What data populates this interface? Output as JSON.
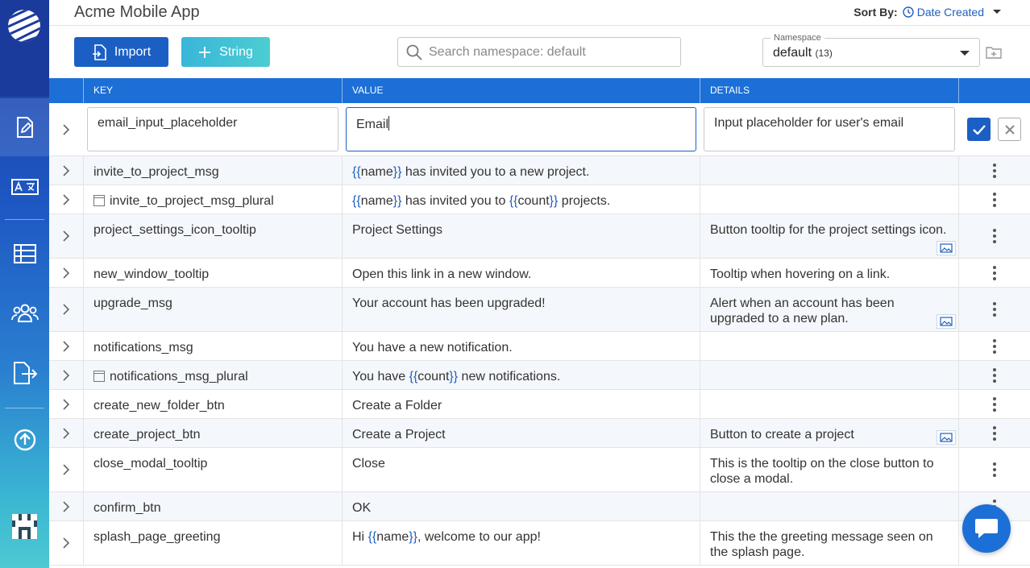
{
  "header": {
    "title": "Acme Mobile App",
    "sort_label": "Sort By:",
    "sort_value": "Date Created"
  },
  "toolbar": {
    "import_label": "Import",
    "string_label": "String",
    "search_placeholder": "Search namespace: default",
    "namespace_label": "Namespace",
    "namespace_value": "default",
    "namespace_count": "(13)"
  },
  "table": {
    "headers": [
      "KEY",
      "VALUE",
      "DETAILS"
    ],
    "edit_row": {
      "key": "email_input_placeholder",
      "value": "Email",
      "details": "Input placeholder for user's email"
    },
    "rows": [
      {
        "key": "invite_to_project_msg",
        "plural": false,
        "value_parts": [
          [
            "ph",
            "{{"
          ],
          [
            "t",
            "name"
          ],
          [
            "ph",
            "}}"
          ],
          [
            "t",
            " has invited you to a new project."
          ]
        ],
        "details": "",
        "image": false
      },
      {
        "key": "invite_to_project_msg_plural",
        "plural": true,
        "value_parts": [
          [
            "ph",
            "{{"
          ],
          [
            "t",
            "name"
          ],
          [
            "ph",
            "}}"
          ],
          [
            "t",
            " has invited you to "
          ],
          [
            "ph",
            "{{"
          ],
          [
            "t",
            "count"
          ],
          [
            "ph",
            "}}"
          ],
          [
            "t",
            " projects."
          ]
        ],
        "details": "",
        "image": false
      },
      {
        "key": "project_settings_icon_tooltip",
        "plural": false,
        "value_parts": [
          [
            "t",
            "Project Settings"
          ]
        ],
        "details": "Button tooltip for the project settings icon.",
        "image": true
      },
      {
        "key": "new_window_tooltip",
        "plural": false,
        "value_parts": [
          [
            "t",
            "Open this link in a new window."
          ]
        ],
        "details": "Tooltip when hovering on a link.",
        "image": false
      },
      {
        "key": "upgrade_msg",
        "plural": false,
        "value_parts": [
          [
            "t",
            "Your account has been upgraded!"
          ]
        ],
        "details": "Alert when an account has been upgraded to a new plan.",
        "image": true
      },
      {
        "key": "notifications_msg",
        "plural": false,
        "value_parts": [
          [
            "t",
            "You have a new notification."
          ]
        ],
        "details": "",
        "image": false
      },
      {
        "key": "notifications_msg_plural",
        "plural": true,
        "value_parts": [
          [
            "t",
            "You have "
          ],
          [
            "ph",
            "{{"
          ],
          [
            "t",
            "count"
          ],
          [
            "ph",
            "}}"
          ],
          [
            "t",
            " new notifications."
          ]
        ],
        "details": "",
        "image": false
      },
      {
        "key": "create_new_folder_btn",
        "plural": false,
        "value_parts": [
          [
            "t",
            "Create a Folder"
          ]
        ],
        "details": "",
        "image": false
      },
      {
        "key": "create_project_btn",
        "plural": false,
        "value_parts": [
          [
            "t",
            "Create a Project"
          ]
        ],
        "details": "Button to create a project",
        "image": true
      },
      {
        "key": "close_modal_tooltip",
        "plural": false,
        "value_parts": [
          [
            "t",
            "Close"
          ]
        ],
        "details": "This is the tooltip on the close button to close a modal.",
        "image": false
      },
      {
        "key": "confirm_btn",
        "plural": false,
        "value_parts": [
          [
            "t",
            "OK"
          ]
        ],
        "details": "",
        "image": false
      },
      {
        "key": "splash_page_greeting",
        "plural": false,
        "value_parts": [
          [
            "t",
            "Hi "
          ],
          [
            "ph",
            "{{"
          ],
          [
            "t",
            "name"
          ],
          [
            "ph",
            "}}"
          ],
          [
            "t",
            ", welcome to our app!"
          ]
        ],
        "details": "This the the greeting message seen on the splash page.",
        "image": false
      }
    ]
  },
  "colors": {
    "primary": "#1c5fc4",
    "header_bg": "#1c6fd6",
    "placeholder": "#1e5fbf"
  }
}
